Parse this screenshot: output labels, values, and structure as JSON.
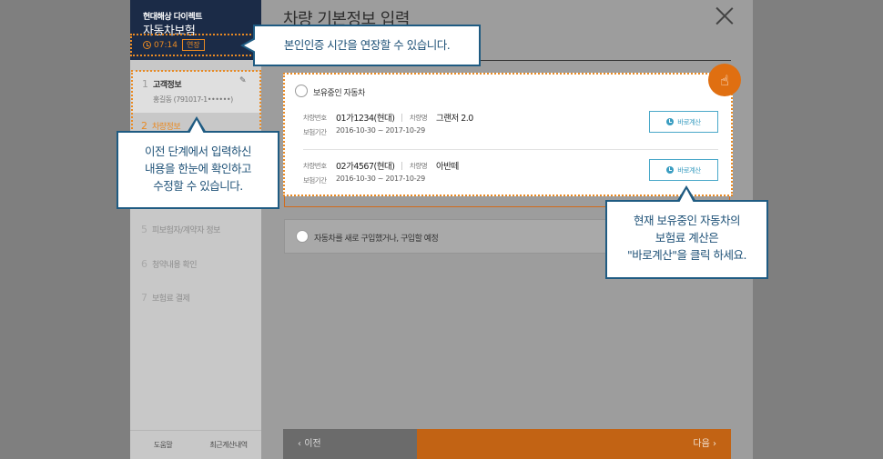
{
  "brand": {
    "company": "현대해상 다이렉트",
    "product": "자동차보험",
    "timer": "07:14",
    "extend_label": "연장"
  },
  "steps": [
    {
      "num": "1",
      "label": "고객정보",
      "sub": "홍길동 (791017-1••••••)"
    },
    {
      "num": "2",
      "label": "차량정보"
    },
    {
      "num": "5",
      "label": "피보험자/계약자 정보"
    },
    {
      "num": "6",
      "label": "청약내용 확인"
    },
    {
      "num": "7",
      "label": "보험료 결제"
    }
  ],
  "sidebar_footer": {
    "help": "도움말",
    "recent": "최근계산내역"
  },
  "main": {
    "title": "차량 기본정보 입력",
    "owned_label": "보유중인 자동차",
    "cars": [
      {
        "plate_key": "차량번호",
        "plate": "01가1234(현대)",
        "model_key": "차량명",
        "model": "그랜저 2.0",
        "period_key": "보험기간",
        "period": "2016-10-30 ~ 2017-10-29",
        "calc": "바로계산"
      },
      {
        "plate_key": "차량번호",
        "plate": "02가4567(현대)",
        "model_key": "차량명",
        "model": "아반떼",
        "period_key": "보험기간",
        "period": "2016-10-30 ~ 2017-10-29",
        "calc": "바로계산"
      }
    ],
    "new_car_label": "자동차를 새로 구입했거나, 구입할 예정",
    "prev": "이전",
    "next": "다음"
  },
  "tooltips": {
    "timer": "본인인증 시간을 연장할 수 있습니다.",
    "edit": [
      "이전 단계에서 입력하신",
      "내용을 한눈에 확인하고",
      "수정할 수 있습니다."
    ],
    "calc": [
      "현재 보유중인 자동차의",
      "보험료 계산은",
      "\"바로계산\"을 클릭 하세요."
    ]
  },
  "colors": {
    "accent": "#e98a23",
    "navy": "#1b2b47",
    "tip_border": "#1f5b82",
    "calc_blue": "#3a9dc1"
  }
}
